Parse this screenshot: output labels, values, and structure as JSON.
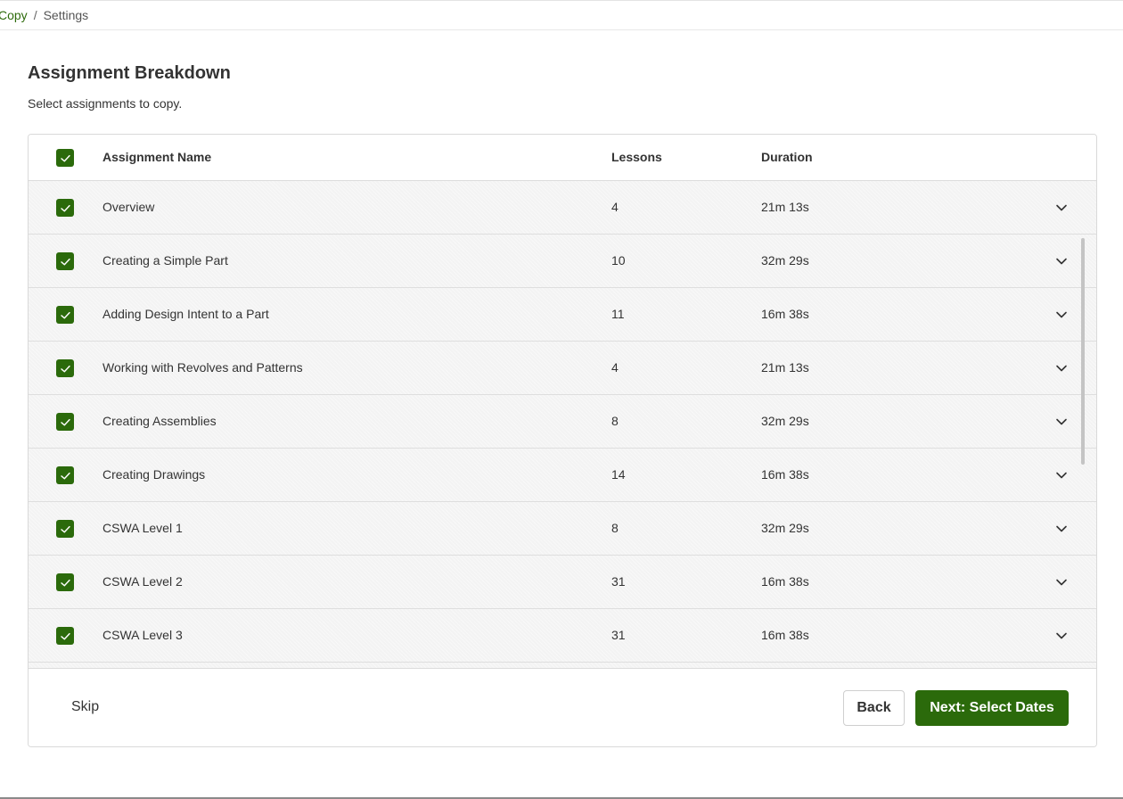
{
  "breadcrumb": {
    "link": "Copy",
    "separator": "/",
    "current": "Settings"
  },
  "header": {
    "title": "Assignment Breakdown",
    "subtitle": "Select assignments to copy."
  },
  "table": {
    "columns": {
      "name": "Assignment Name",
      "lessons": "Lessons",
      "duration": "Duration"
    },
    "select_all_checked": true,
    "rows": [
      {
        "name": "Overview",
        "lessons": "4",
        "duration": "21m 13s",
        "checked": true
      },
      {
        "name": "Creating a Simple Part",
        "lessons": "10",
        "duration": "32m 29s",
        "checked": true
      },
      {
        "name": "Adding Design Intent to a Part",
        "lessons": "11",
        "duration": "16m 38s",
        "checked": true
      },
      {
        "name": "Working with Revolves and Patterns",
        "lessons": "4",
        "duration": "21m 13s",
        "checked": true
      },
      {
        "name": "Creating Assemblies",
        "lessons": "8",
        "duration": "32m 29s",
        "checked": true
      },
      {
        "name": "Creating Drawings",
        "lessons": "14",
        "duration": "16m 38s",
        "checked": true
      },
      {
        "name": "CSWA Level 1",
        "lessons": "8",
        "duration": "32m 29s",
        "checked": true
      },
      {
        "name": "CSWA Level 2",
        "lessons": "31",
        "duration": "16m 38s",
        "checked": true
      },
      {
        "name": "CSWA Level 3",
        "lessons": "31",
        "duration": "16m 38s",
        "checked": true
      }
    ]
  },
  "footer": {
    "skip_label": "Skip",
    "back_label": "Back",
    "next_label": "Next: Select Dates"
  },
  "colors": {
    "accent": "#2b6a0b",
    "link": "#2e6b0c",
    "row_background": "#f3f3f3"
  },
  "icons": {
    "checkbox": "checkmark-icon",
    "row_expand": "chevron-down-icon"
  }
}
